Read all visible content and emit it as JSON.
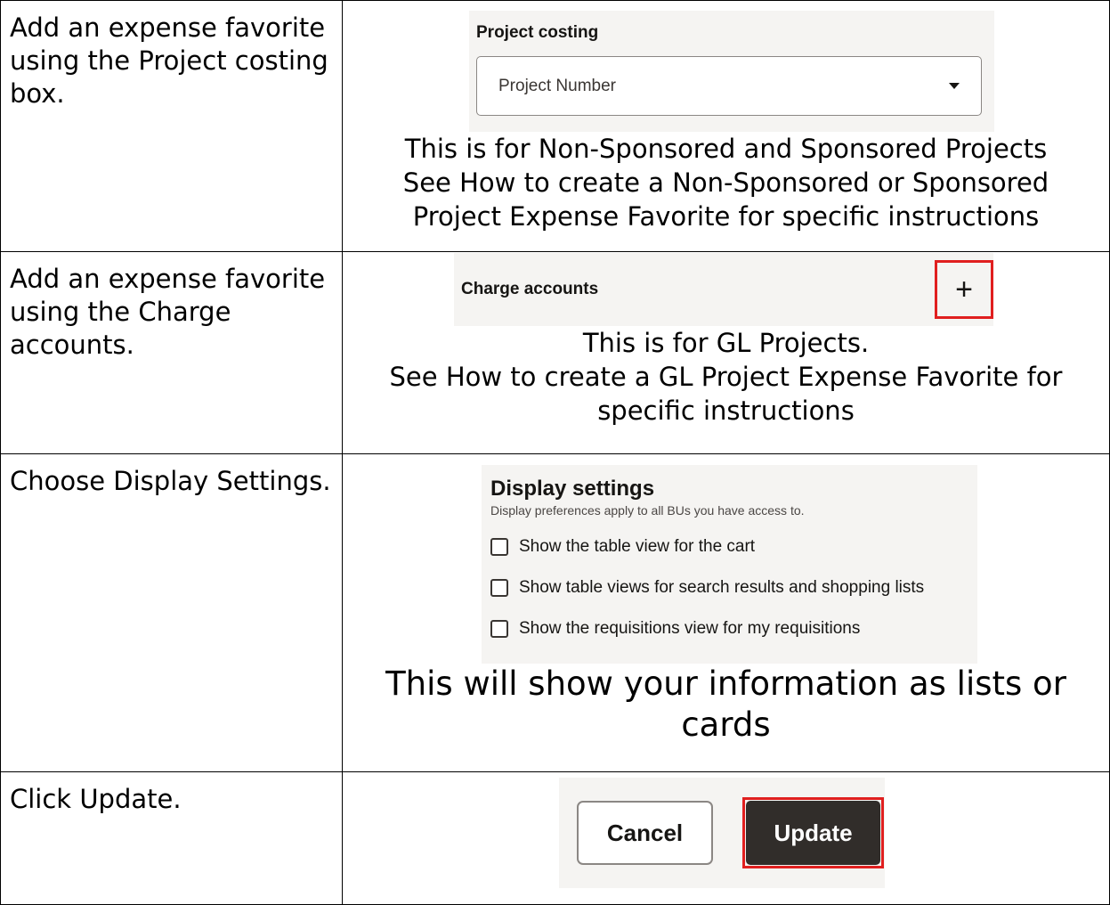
{
  "rows": [
    {
      "instruction": "Add an expense favorite using the Project costing box.",
      "screenshot": {
        "label": "Project costing",
        "select_value": "Project Number",
        "select_icon": "chevron-down-icon"
      },
      "caption_lines": [
        "This is for Non-Sponsored and Sponsored Projects",
        "See How to create a Non-Sponsored or Sponsored",
        "Project Expense Favorite for specific instructions"
      ]
    },
    {
      "instruction": "Add an expense favorite using the Charge accounts.",
      "screenshot": {
        "label": "Charge accounts",
        "add_icon_glyph": "+",
        "add_icon": "plus-icon",
        "highlight_color": "#e01f1f"
      },
      "caption_lines": [
        "This is for GL Projects.",
        "See How to create a GL Project Expense Favorite for",
        "specific instructions"
      ]
    },
    {
      "instruction": "Choose Display Settings.",
      "screenshot": {
        "title": "Display settings",
        "subtitle": "Display preferences apply to all BUs you have access to.",
        "options": [
          {
            "label": "Show the table view for the cart",
            "checked": false
          },
          {
            "label": "Show table views for search results and shopping lists",
            "checked": false
          },
          {
            "label": "Show the requisitions view for my requisitions",
            "checked": false
          }
        ]
      },
      "caption_lines": [
        "This will show your information as lists or",
        "cards"
      ]
    },
    {
      "instruction": "Click Update.",
      "screenshot": {
        "cancel_label": "Cancel",
        "update_label": "Update",
        "update_color": "#312d2a",
        "highlight_color": "#e01f1f"
      }
    }
  ]
}
